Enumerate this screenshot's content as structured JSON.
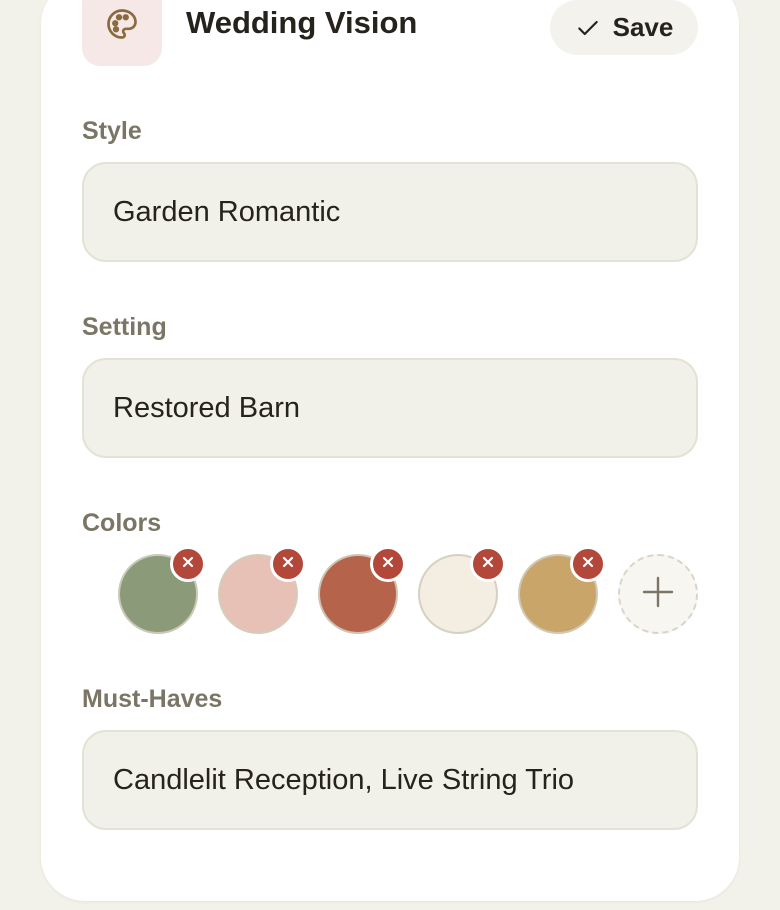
{
  "header": {
    "title": "Wedding Vision",
    "icon": "palette-icon",
    "save_label": "Save",
    "save_icon": "check-icon"
  },
  "style": {
    "label": "Style",
    "value": "Garden Romantic"
  },
  "setting": {
    "label": "Setting",
    "value": "Restored Barn"
  },
  "colors": {
    "label": "Colors",
    "swatches": [
      "#8b9a78",
      "#e8c1b6",
      "#b5644b",
      "#f4ede2",
      "#c9a56a"
    ],
    "remove_icon": "close-icon",
    "add_icon": "plus-icon"
  },
  "must_haves": {
    "label": "Must-Haves",
    "value": "Candlelit Reception, Live String Trio"
  },
  "theme": {
    "accent": "#b3473a",
    "field_bg": "#f1f1e9",
    "page_bg": "#f2f2ea"
  }
}
